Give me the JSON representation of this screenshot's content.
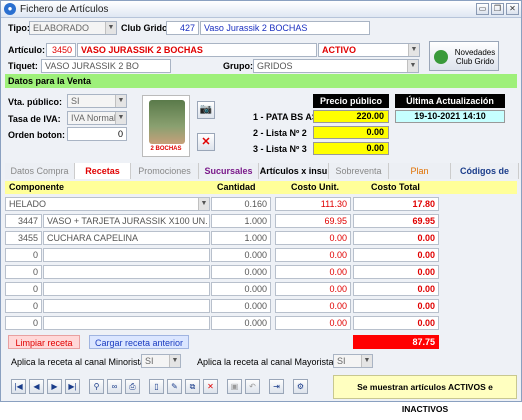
{
  "window": {
    "title": "Fichero de Artículos"
  },
  "header": {
    "tipo_label": "Tipo:",
    "tipo_value": "ELABORADO",
    "grido_label": "Club Grido:",
    "grido_code": "427",
    "grido_name": "Vaso Jurassik 2 BOCHAS",
    "articulo_label": "Artículo:",
    "articulo_code": "3450",
    "articulo_name": "VASO JURASSIK 2 BOCHAS",
    "estado": "ACTIVO",
    "tiquet_label": "Tiquet:",
    "tiquet_value": "VASO JURASSIK 2 BO",
    "grupo_label": "Grupo:",
    "grupo_value": "GRIDOS",
    "novedades_label1": "Novedades",
    "novedades_label2": "Club Grido"
  },
  "venta": {
    "section_title": "Datos para la Venta",
    "vta_publico_label": "Vta. público:",
    "vta_publico_value": "SI",
    "tasa_iva_label": "Tasa de IVA:",
    "tasa_iva_value": "IVA Normal",
    "orden_boton_label": "Orden boton:",
    "orden_boton_value": "0",
    "image_caption": "2 BOCHAS",
    "precio_publico_title": "Precio público",
    "ultima_act_title": "Última Actualización",
    "ultima_act_value": "19-10-2021 14:10",
    "precios": [
      {
        "label": "1 - PATA BS AS :",
        "value": "220.00"
      },
      {
        "label": "2 - Lista Nº 2",
        "value": "0.00"
      },
      {
        "label": "3 - Lista Nº 3",
        "value": "0.00"
      }
    ]
  },
  "tabs": [
    "Datos Compra",
    "Recetas",
    "Promociones",
    "Sucursales",
    "Artículos x insu",
    "Sobreventa",
    "Plan Comercial",
    "Códigos de barra"
  ],
  "tab_colors": [
    "#888888",
    "#e00000",
    "#888888",
    "#7a1a8a",
    "#000000",
    "#888888",
    "#e07000",
    "#1a3c8a"
  ],
  "recetas": {
    "headers": {
      "componente": "Componente",
      "cantidad": "Cantidad",
      "costo_unit": "Costo Unit.",
      "costo_total": "Costo Total"
    },
    "rows": [
      {
        "code": "",
        "name": "HELADO",
        "cantidad": "0.160",
        "costo_unit": "111.30",
        "costo_total": "17.80"
      },
      {
        "code": "3447",
        "name": "VASO + TARJETA JURASSIK X100 UN.",
        "cantidad": "1.000",
        "costo_unit": "69.95",
        "costo_total": "69.95"
      },
      {
        "code": "3455",
        "name": "CUCHARA CAPELINA",
        "cantidad": "1.000",
        "costo_unit": "0.00",
        "costo_total": "0.00"
      },
      {
        "code": "0",
        "name": "",
        "cantidad": "0.000",
        "costo_unit": "0.00",
        "costo_total": "0.00"
      },
      {
        "code": "0",
        "name": "",
        "cantidad": "0.000",
        "costo_unit": "0.00",
        "costo_total": "0.00"
      },
      {
        "code": "0",
        "name": "",
        "cantidad": "0.000",
        "costo_unit": "0.00",
        "costo_total": "0.00"
      },
      {
        "code": "0",
        "name": "",
        "cantidad": "0.000",
        "costo_unit": "0.00",
        "costo_total": "0.00"
      },
      {
        "code": "0",
        "name": "",
        "cantidad": "0.000",
        "costo_unit": "0.00",
        "costo_total": "0.00"
      }
    ],
    "total": "87.75",
    "limpiar_label": "Limpiar receta",
    "cargar_label": "Cargar receta anterior",
    "minorista_label": "Aplica la receta al canal Minorista?",
    "minorista_value": "SI",
    "mayorista_label": "Aplica la receta al canal Mayorista?",
    "mayorista_value": "SI"
  },
  "footer": {
    "status": "Se muestran artículos ACTIVOS e INACTIVOS"
  }
}
